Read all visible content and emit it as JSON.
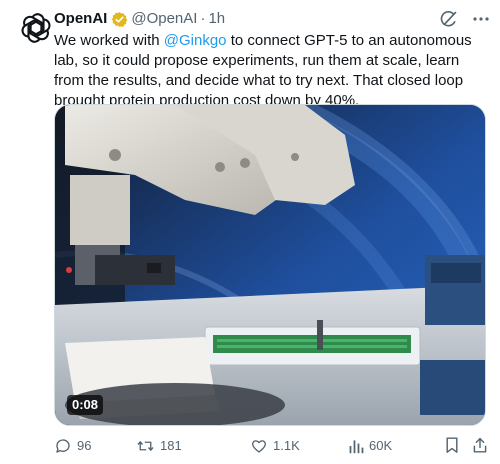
{
  "author": {
    "name": "OpenAI",
    "handle": "@OpenAI",
    "time": "1h",
    "verified_color": "#e2b719"
  },
  "tweet": {
    "text_part1": "We worked with ",
    "mention": "@Ginkgo",
    "text_part2": " to connect GPT-5 to an autonomous lab, so it could propose experiments, run them at scale, learn from the results, and decide what to try next. That closed loop brought protein production cost down by 40%."
  },
  "media": {
    "duration": "0:08"
  },
  "actions": {
    "replies": "96",
    "reposts": "181",
    "likes": "1.1K",
    "views": "60K"
  },
  "colors": {
    "text": "#0f1419",
    "secondary": "#536471",
    "link": "#1d9bf0",
    "border": "#cfd9de"
  },
  "icons": [
    "openai-logo-icon",
    "verified-badge-icon",
    "grok-icon",
    "more-icon",
    "reply-icon",
    "retweet-icon",
    "heart-icon",
    "views-icon",
    "bookmark-icon",
    "share-icon"
  ]
}
